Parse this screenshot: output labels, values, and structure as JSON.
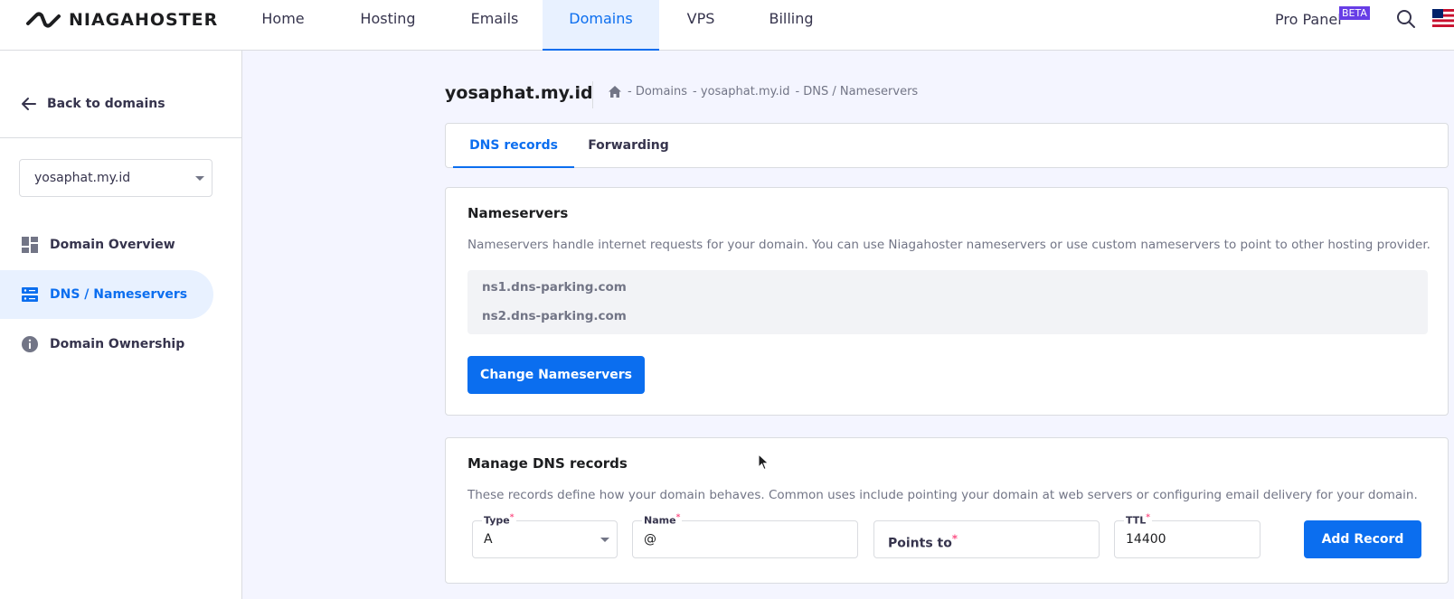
{
  "brand": {
    "name": "NIAGAHOSTER",
    "logo_icon": "infinity-logo-icon"
  },
  "nav": {
    "items": [
      {
        "label": "Home"
      },
      {
        "label": "Hosting"
      },
      {
        "label": "Emails"
      },
      {
        "label": "Domains",
        "active": true
      },
      {
        "label": "VPS"
      },
      {
        "label": "Billing"
      }
    ],
    "pro_panel": "Pro Panel",
    "beta": "BETA",
    "accent": "#0b6eef"
  },
  "sidebar": {
    "back_label": "Back to domains",
    "selected_domain": "yosaphat.my.id",
    "items": [
      {
        "label": "Domain Overview",
        "icon": "dashboard-icon"
      },
      {
        "label": "DNS / Nameservers",
        "icon": "server-icon",
        "active": true
      },
      {
        "label": "Domain Ownership",
        "icon": "info-icon"
      }
    ]
  },
  "page": {
    "title": "yosaphat.my.id",
    "breadcrumb": [
      "- Domains",
      "- yosaphat.my.id",
      "- DNS / Nameservers"
    ]
  },
  "tabs": [
    {
      "label": "DNS records",
      "active": true
    },
    {
      "label": "Forwarding"
    }
  ],
  "nameservers": {
    "title": "Nameservers",
    "description": "Nameservers handle internet requests for your domain. You can use Niagahoster nameservers or use custom nameservers to point to other hosting provider.",
    "servers": [
      "ns1.dns-parking.com",
      "ns2.dns-parking.com"
    ],
    "change_button": "Change Nameservers"
  },
  "dns_records": {
    "title": "Manage DNS records",
    "description": "These records define how your domain behaves. Common uses include pointing your domain at web servers or configuring email delivery for your domain.",
    "type_label": "Type",
    "type_value": "A",
    "name_label": "Name",
    "name_value": "@",
    "points_to_placeholder": "Points to",
    "ttl_label": "TTL",
    "ttl_value": "14400",
    "required_mark": "*",
    "add_button": "Add Record"
  }
}
